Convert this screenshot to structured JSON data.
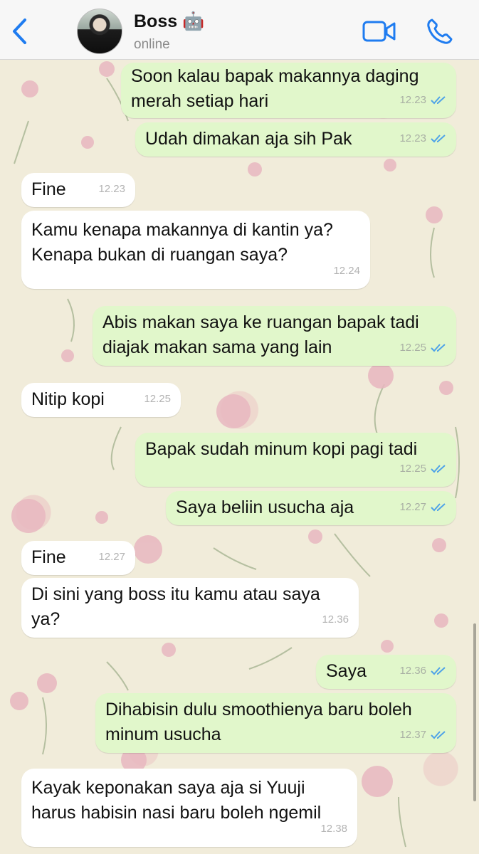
{
  "header": {
    "contact_name": "Boss",
    "contact_emoji": "🤖",
    "status": "online",
    "accent_color": "#1f7cf0"
  },
  "icons": {
    "back": "chevron-left-icon",
    "video": "video-call-icon",
    "call": "phone-icon",
    "read_receipt": "double-check-icon"
  },
  "messages": [
    {
      "dir": "out",
      "text": "Soon kalau bapak makannya daging\nmerah setiap hari",
      "time": "12.23",
      "read": true
    },
    {
      "dir": "out",
      "text": "Udah dimakan aja sih Pak",
      "time": "12.23",
      "read": true
    },
    {
      "dir": "in",
      "text": "Fine",
      "time": "12.23"
    },
    {
      "dir": "in",
      "text": "Kamu kenapa makannya di kantin ya?\nKenapa bukan di ruangan saya?",
      "time": "12.24"
    },
    {
      "dir": "out",
      "text": "Abis makan saya ke ruangan bapak tadi\ndiajak makan sama yang lain",
      "time": "12.25",
      "read": true
    },
    {
      "dir": "in",
      "text": "Nitip kopi",
      "time": "12.25"
    },
    {
      "dir": "out",
      "text": "Bapak sudah minum kopi pagi tadi",
      "time": "12.25",
      "read": true
    },
    {
      "dir": "out",
      "text": "Saya beliin usucha aja",
      "time": "12.27",
      "read": true
    },
    {
      "dir": "in",
      "text": "Fine",
      "time": "12.27"
    },
    {
      "dir": "in",
      "text": "Di sini yang boss itu kamu atau saya\nya?",
      "time": "12.36"
    },
    {
      "dir": "out",
      "text": "Saya",
      "time": "12.36",
      "read": true
    },
    {
      "dir": "out",
      "text": "Dihabisin dulu smoothienya baru boleh\nminum usucha",
      "time": "12.37",
      "read": true
    },
    {
      "dir": "in",
      "text": "Kayak keponakan saya aja si Yuuji\nharus habisin nasi baru boleh ngemil",
      "time": "12.38"
    }
  ],
  "colors": {
    "outgoing_bubble": "#e1f7cb",
    "incoming_bubble": "#ffffff",
    "read_tick": "#4fa3e8"
  }
}
